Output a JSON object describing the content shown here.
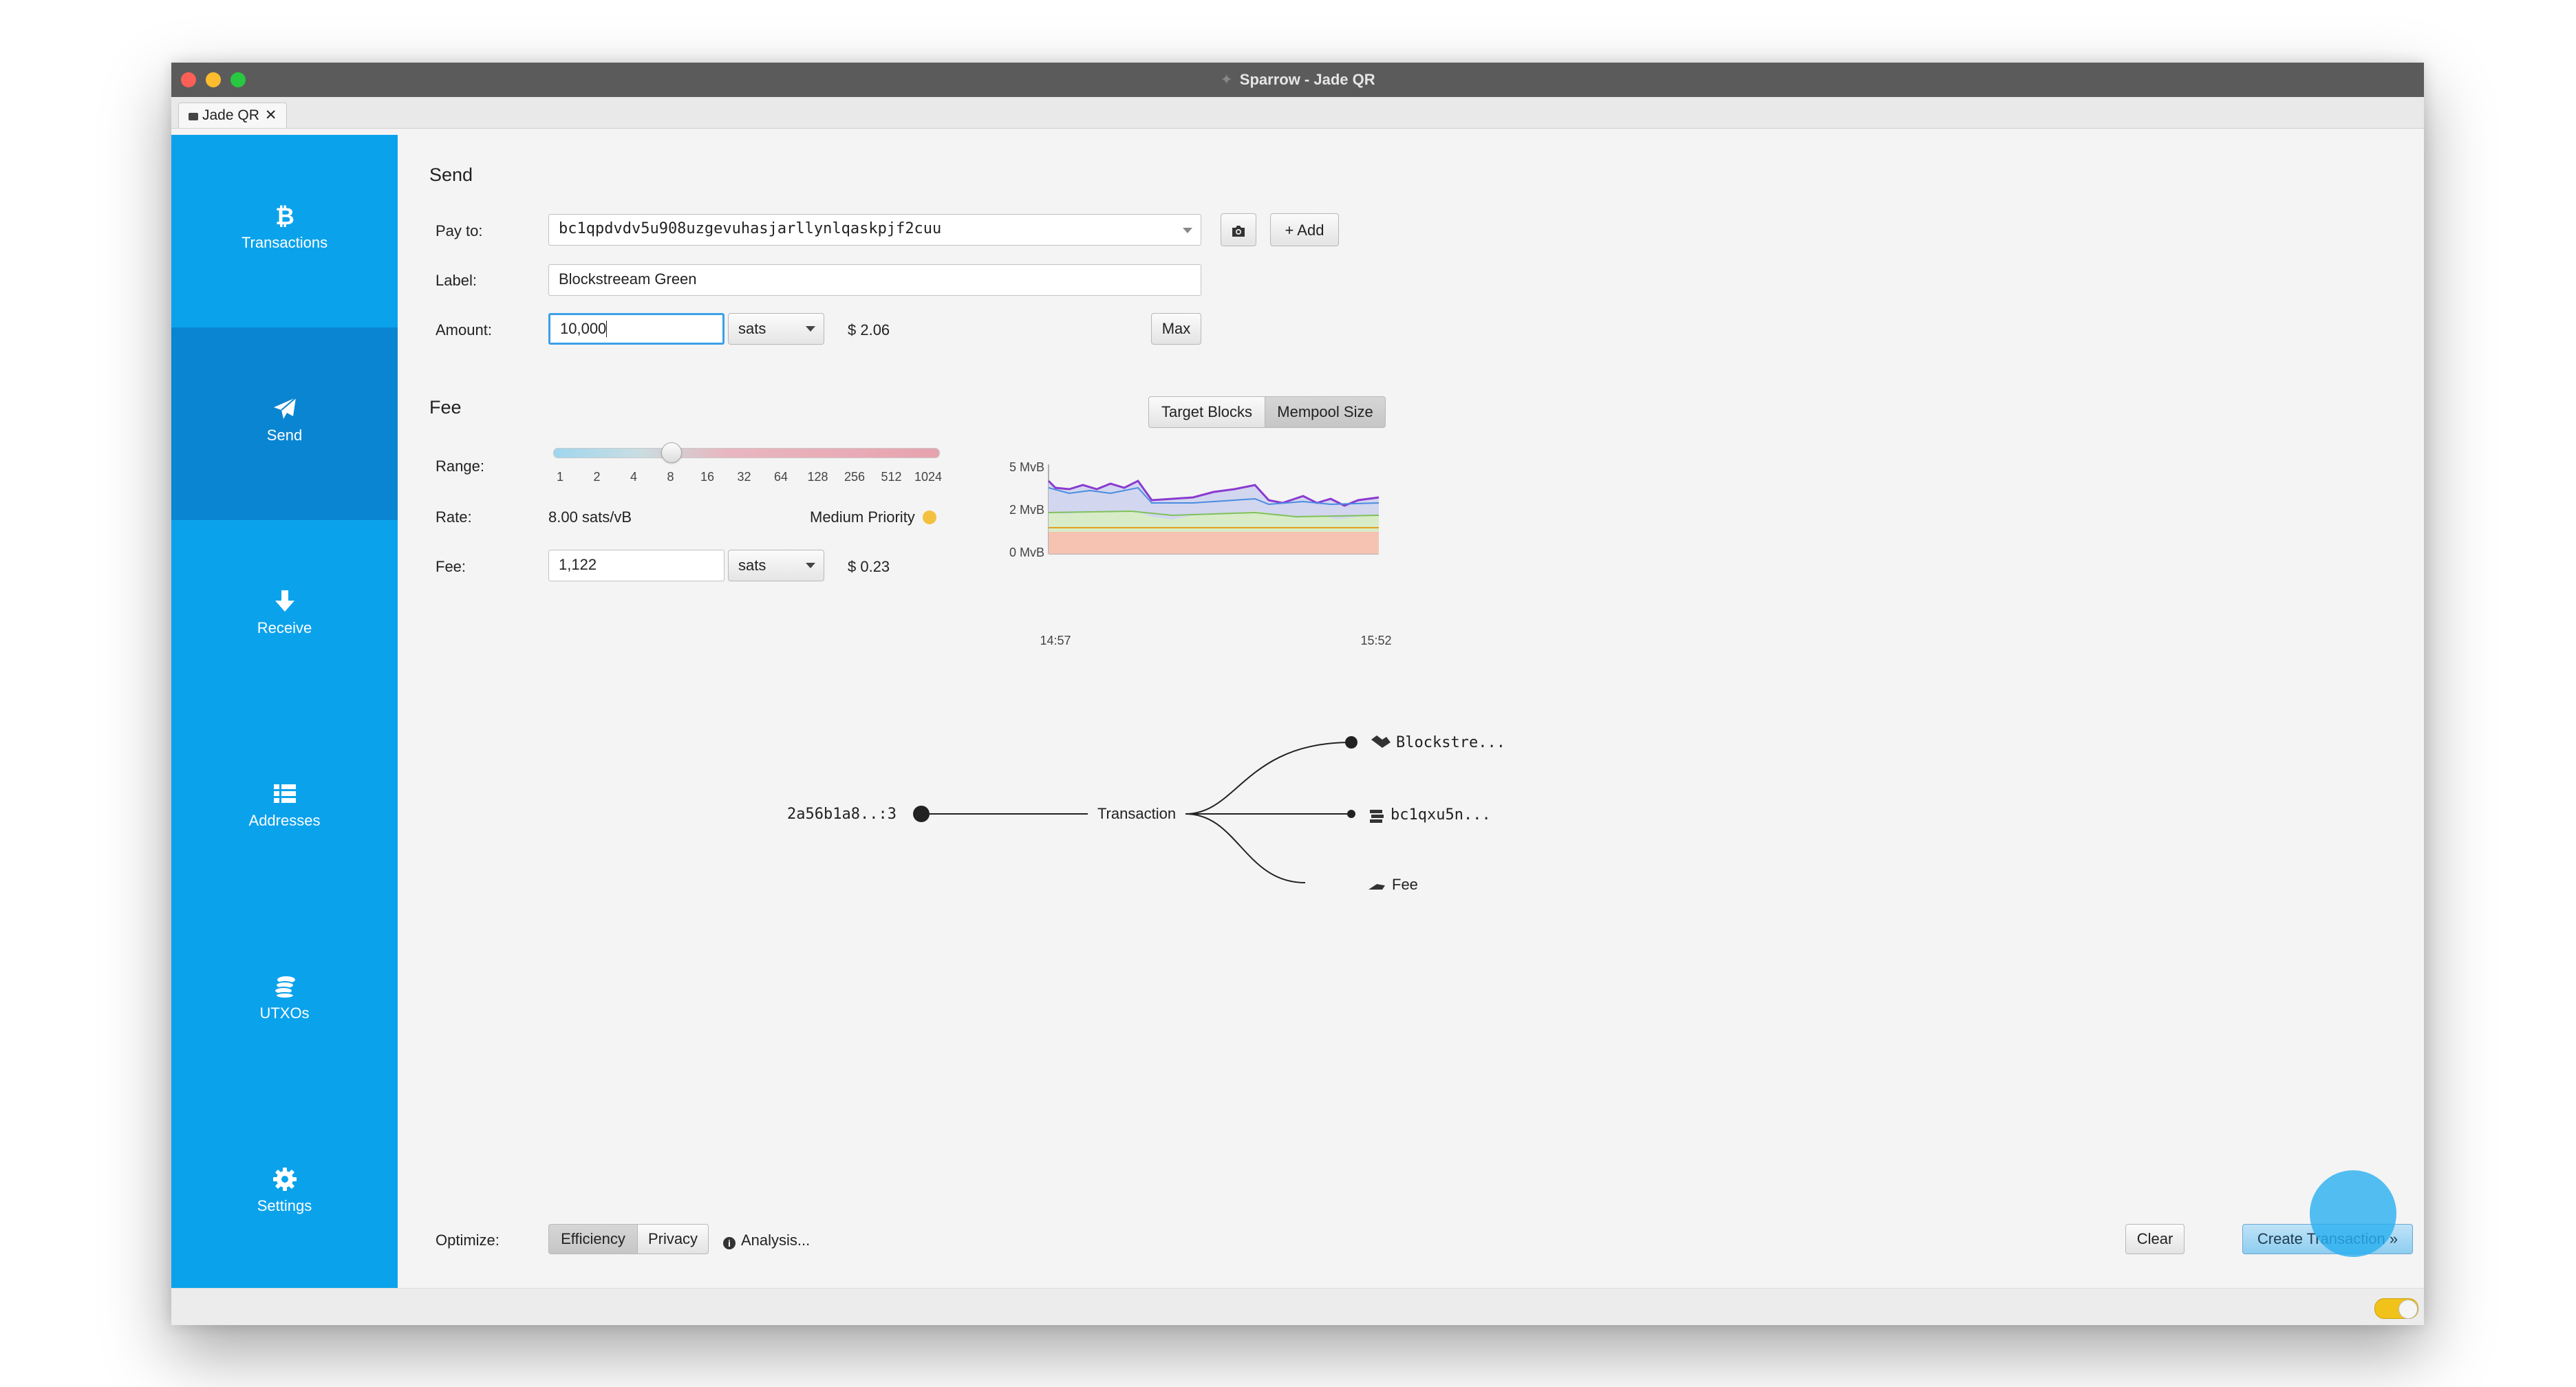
{
  "window": {
    "title": "Sparrow - Jade QR",
    "tab": "Jade QR"
  },
  "sidebar": {
    "items": [
      {
        "label": "Transactions",
        "icon": "bitcoin-icon"
      },
      {
        "label": "Send",
        "icon": "paper-plane-icon"
      },
      {
        "label": "Receive",
        "icon": "arrow-down-icon"
      },
      {
        "label": "Addresses",
        "icon": "list-icon"
      },
      {
        "label": "UTXOs",
        "icon": "coins-icon"
      },
      {
        "label": "Settings",
        "icon": "gear-icon"
      }
    ],
    "active": "Send"
  },
  "send": {
    "header": "Send",
    "pay_to_label": "Pay to:",
    "pay_to_value": "bc1qpdvdv5u908uzgevuhasjarllynlqaskpjf2cuu",
    "add_label": "+ Add",
    "label_label": "Label:",
    "label_value": "Blockstreeam Green",
    "amount_label": "Amount:",
    "amount_value": "10,000",
    "amount_unit": "sats",
    "amount_fiat": "$ 2.06",
    "max_label": "Max"
  },
  "fee": {
    "header": "Fee",
    "target_blocks_label": "Target Blocks",
    "mempool_size_label": "Mempool Size",
    "range_label": "Range:",
    "range_ticks": [
      "1",
      "2",
      "4",
      "8",
      "16",
      "32",
      "64",
      "128",
      "256",
      "512",
      "1024"
    ],
    "range_position": 0.3,
    "rate_label": "Rate:",
    "rate_value": "8.00 sats/vB",
    "priority": "Medium Priority",
    "priority_color": "#f3c040",
    "fee_label": "Fee:",
    "fee_value": "1,122",
    "fee_unit": "sats",
    "fee_fiat": "$ 0.23"
  },
  "mempool_chart": {
    "y_ticks": [
      "5 MvB",
      "2 MvB",
      "0 MvB"
    ],
    "x_ticks": [
      "14:57",
      "15:52"
    ]
  },
  "tx_diagram": {
    "input": "2a56b1a8..:3",
    "center": "Transaction",
    "outputs": [
      "Blockstre...",
      "bc1qxu5n...",
      "Fee"
    ]
  },
  "bottom": {
    "optimize_label": "Optimize:",
    "efficiency_label": "Efficiency",
    "privacy_label": "Privacy",
    "analysis_label": "Analysis...",
    "clear_label": "Clear",
    "create_label": "Create Transaction »"
  },
  "colors": {
    "accent": "#0ba2ec",
    "accent_active": "#0a85d2",
    "titlebar": "#5b5b5b"
  }
}
